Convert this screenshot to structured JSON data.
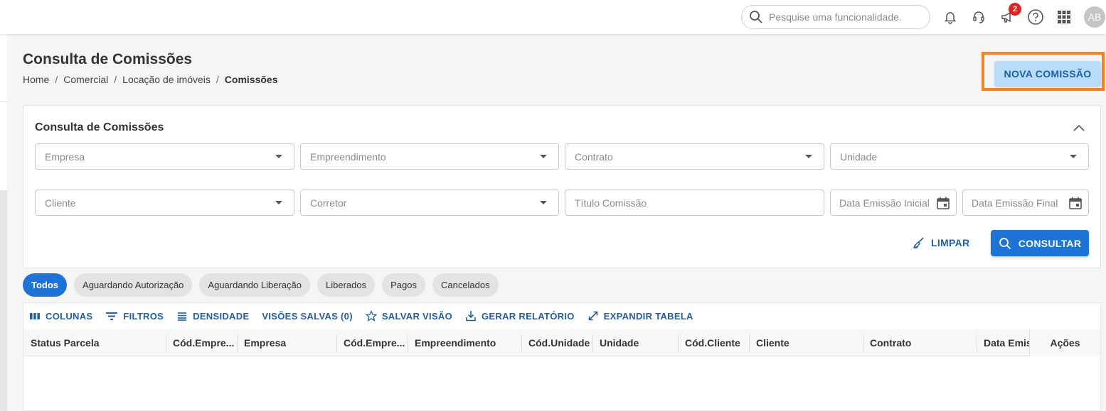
{
  "topbar": {
    "search_placeholder": "Pesquise uma funcionalidade.",
    "notification_badge": "2",
    "avatar_initials": "AB"
  },
  "page": {
    "title": "Consulta de Comissões",
    "breadcrumb": [
      "Home",
      "Comercial",
      "Locação de imóveis",
      "Comissões"
    ],
    "breadcrumb_sep": "/",
    "new_button": "NOVA COMISSÃO"
  },
  "filters": {
    "title": "Consulta de Comissões",
    "fields": {
      "empresa": "Empresa",
      "empreendimento": "Empreendimento",
      "contrato": "Contrato",
      "unidade": "Unidade",
      "cliente": "Cliente",
      "corretor": "Corretor",
      "titulo": "Título Comissão",
      "data_inicial": "Data Emissão Inicial",
      "data_final": "Data Emissão Final"
    },
    "clear_label": "LIMPAR",
    "consult_label": "CONSULTAR"
  },
  "chips": [
    "Todos",
    "Aguardando Autorização",
    "Aguardando Liberação",
    "Liberados",
    "Pagos",
    "Cancelados"
  ],
  "toolbar": {
    "colunas": "COLUNAS",
    "filtros": "FILTROS",
    "densidade": "DENSIDADE",
    "visoes": "VISÕES SALVAS (0)",
    "salvar": "SALVAR VISÃO",
    "relatorio": "GERAR RELATÓRIO",
    "expandir": "EXPANDIR TABELA"
  },
  "table": {
    "columns": [
      "Status Parcela",
      "Cód.Empre...",
      "Empresa",
      "Cód.Empre...",
      "Empreendimento",
      "Cód.Unidade",
      "Unidade",
      "Cód.Cliente",
      "Cliente",
      "Contrato",
      "Data Emis"
    ],
    "actions_label": "Ações"
  },
  "colors": {
    "primary": "#1e74d6",
    "primary_light": "#b9dcfa",
    "highlight": "#f58220",
    "badge": "#e32222"
  }
}
